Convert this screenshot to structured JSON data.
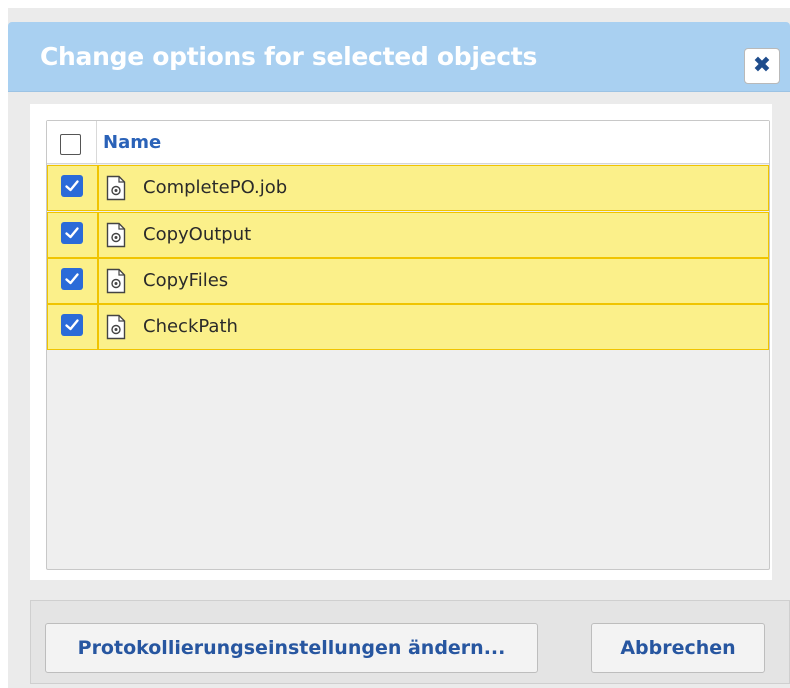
{
  "dialog": {
    "title": "Change options for selected objects",
    "close_icon": "close-icon"
  },
  "grid": {
    "header": {
      "name_label": "Name",
      "select_all_checked": false
    },
    "rows": [
      {
        "label": "CompletePO.job",
        "checked": true,
        "icon": "job-file-icon"
      },
      {
        "label": "CopyOutput",
        "checked": true,
        "icon": "job-file-icon"
      },
      {
        "label": "CopyFiles",
        "checked": true,
        "icon": "job-file-icon"
      },
      {
        "label": "CheckPath",
        "checked": true,
        "icon": "job-file-icon"
      }
    ]
  },
  "footer": {
    "log_settings_label": "Protokollierungseinstellungen ändern...",
    "cancel_label": "Abbrechen"
  },
  "colors": {
    "titlebar": "#a9d0f1",
    "selected_row": "#fbf08a",
    "selected_border": "#f0c400",
    "checkbox": "#2b6bd8",
    "accent_text": "#2756a0"
  }
}
